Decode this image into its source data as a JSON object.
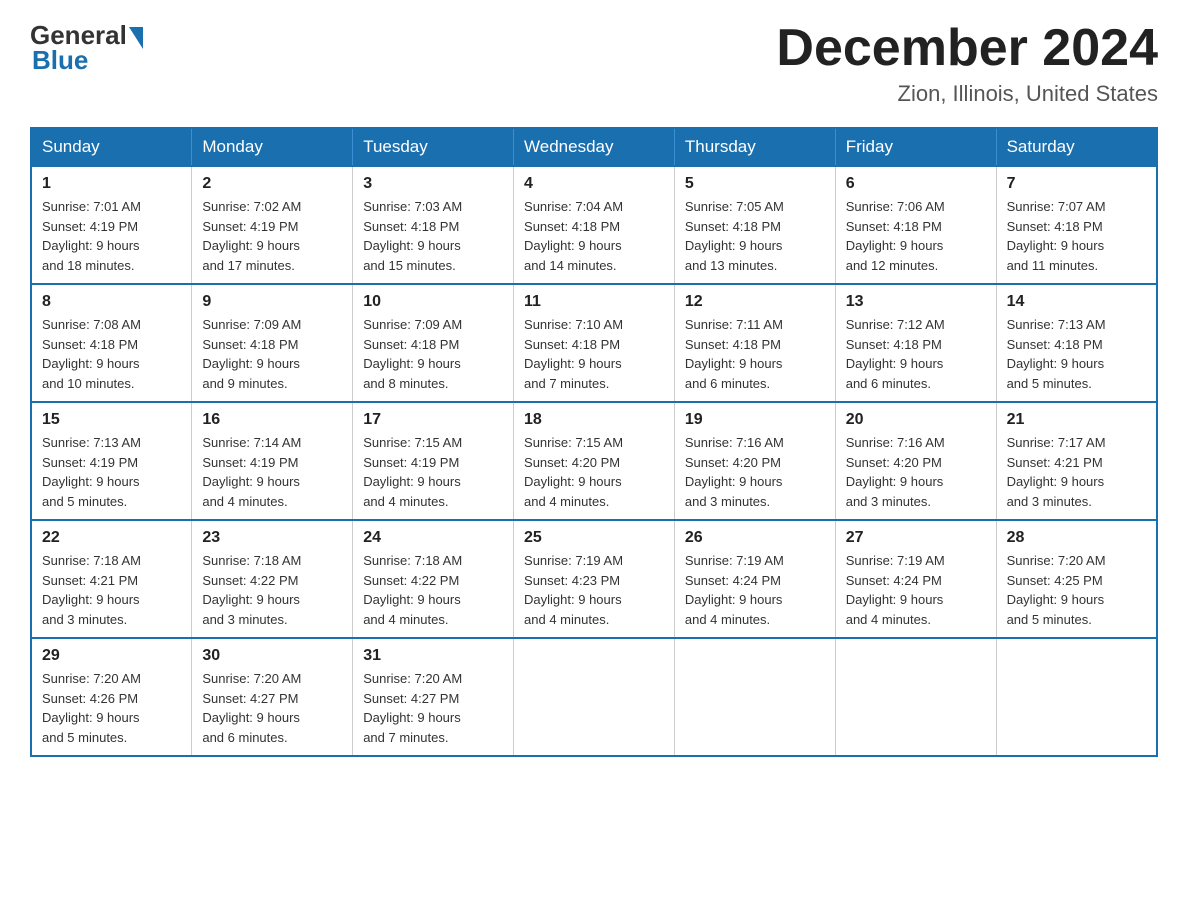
{
  "header": {
    "logo_general": "General",
    "logo_blue": "Blue",
    "month_year": "December 2024",
    "location": "Zion, Illinois, United States"
  },
  "days_of_week": [
    "Sunday",
    "Monday",
    "Tuesday",
    "Wednesday",
    "Thursday",
    "Friday",
    "Saturday"
  ],
  "weeks": [
    [
      {
        "day": "1",
        "sunrise": "7:01 AM",
        "sunset": "4:19 PM",
        "daylight": "9 hours and 18 minutes."
      },
      {
        "day": "2",
        "sunrise": "7:02 AM",
        "sunset": "4:19 PM",
        "daylight": "9 hours and 17 minutes."
      },
      {
        "day": "3",
        "sunrise": "7:03 AM",
        "sunset": "4:18 PM",
        "daylight": "9 hours and 15 minutes."
      },
      {
        "day": "4",
        "sunrise": "7:04 AM",
        "sunset": "4:18 PM",
        "daylight": "9 hours and 14 minutes."
      },
      {
        "day": "5",
        "sunrise": "7:05 AM",
        "sunset": "4:18 PM",
        "daylight": "9 hours and 13 minutes."
      },
      {
        "day": "6",
        "sunrise": "7:06 AM",
        "sunset": "4:18 PM",
        "daylight": "9 hours and 12 minutes."
      },
      {
        "day": "7",
        "sunrise": "7:07 AM",
        "sunset": "4:18 PM",
        "daylight": "9 hours and 11 minutes."
      }
    ],
    [
      {
        "day": "8",
        "sunrise": "7:08 AM",
        "sunset": "4:18 PM",
        "daylight": "9 hours and 10 minutes."
      },
      {
        "day": "9",
        "sunrise": "7:09 AM",
        "sunset": "4:18 PM",
        "daylight": "9 hours and 9 minutes."
      },
      {
        "day": "10",
        "sunrise": "7:09 AM",
        "sunset": "4:18 PM",
        "daylight": "9 hours and 8 minutes."
      },
      {
        "day": "11",
        "sunrise": "7:10 AM",
        "sunset": "4:18 PM",
        "daylight": "9 hours and 7 minutes."
      },
      {
        "day": "12",
        "sunrise": "7:11 AM",
        "sunset": "4:18 PM",
        "daylight": "9 hours and 6 minutes."
      },
      {
        "day": "13",
        "sunrise": "7:12 AM",
        "sunset": "4:18 PM",
        "daylight": "9 hours and 6 minutes."
      },
      {
        "day": "14",
        "sunrise": "7:13 AM",
        "sunset": "4:18 PM",
        "daylight": "9 hours and 5 minutes."
      }
    ],
    [
      {
        "day": "15",
        "sunrise": "7:13 AM",
        "sunset": "4:19 PM",
        "daylight": "9 hours and 5 minutes."
      },
      {
        "day": "16",
        "sunrise": "7:14 AM",
        "sunset": "4:19 PM",
        "daylight": "9 hours and 4 minutes."
      },
      {
        "day": "17",
        "sunrise": "7:15 AM",
        "sunset": "4:19 PM",
        "daylight": "9 hours and 4 minutes."
      },
      {
        "day": "18",
        "sunrise": "7:15 AM",
        "sunset": "4:20 PM",
        "daylight": "9 hours and 4 minutes."
      },
      {
        "day": "19",
        "sunrise": "7:16 AM",
        "sunset": "4:20 PM",
        "daylight": "9 hours and 3 minutes."
      },
      {
        "day": "20",
        "sunrise": "7:16 AM",
        "sunset": "4:20 PM",
        "daylight": "9 hours and 3 minutes."
      },
      {
        "day": "21",
        "sunrise": "7:17 AM",
        "sunset": "4:21 PM",
        "daylight": "9 hours and 3 minutes."
      }
    ],
    [
      {
        "day": "22",
        "sunrise": "7:18 AM",
        "sunset": "4:21 PM",
        "daylight": "9 hours and 3 minutes."
      },
      {
        "day": "23",
        "sunrise": "7:18 AM",
        "sunset": "4:22 PM",
        "daylight": "9 hours and 3 minutes."
      },
      {
        "day": "24",
        "sunrise": "7:18 AM",
        "sunset": "4:22 PM",
        "daylight": "9 hours and 4 minutes."
      },
      {
        "day": "25",
        "sunrise": "7:19 AM",
        "sunset": "4:23 PM",
        "daylight": "9 hours and 4 minutes."
      },
      {
        "day": "26",
        "sunrise": "7:19 AM",
        "sunset": "4:24 PM",
        "daylight": "9 hours and 4 minutes."
      },
      {
        "day": "27",
        "sunrise": "7:19 AM",
        "sunset": "4:24 PM",
        "daylight": "9 hours and 4 minutes."
      },
      {
        "day": "28",
        "sunrise": "7:20 AM",
        "sunset": "4:25 PM",
        "daylight": "9 hours and 5 minutes."
      }
    ],
    [
      {
        "day": "29",
        "sunrise": "7:20 AM",
        "sunset": "4:26 PM",
        "daylight": "9 hours and 5 minutes."
      },
      {
        "day": "30",
        "sunrise": "7:20 AM",
        "sunset": "4:27 PM",
        "daylight": "9 hours and 6 minutes."
      },
      {
        "day": "31",
        "sunrise": "7:20 AM",
        "sunset": "4:27 PM",
        "daylight": "9 hours and 7 minutes."
      },
      null,
      null,
      null,
      null
    ]
  ],
  "labels": {
    "sunrise": "Sunrise:",
    "sunset": "Sunset:",
    "daylight": "Daylight:"
  }
}
